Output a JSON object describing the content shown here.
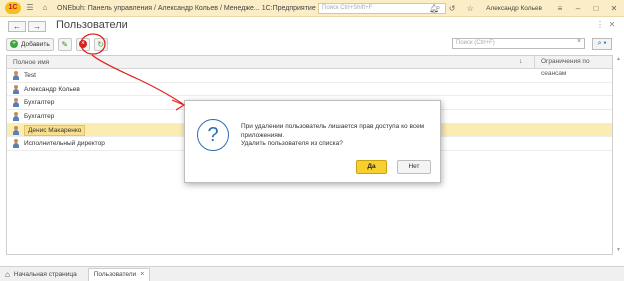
{
  "titlebar": {
    "logo": "1С",
    "title": "ONEbuh: Панель управления / Александр Кольев / Менедже... 1С:Предприятие",
    "search_placeholder": "Поиск Ctrl+Shift+F",
    "user": "Александр Кольев"
  },
  "page": {
    "title": "Пользователи"
  },
  "toolbar": {
    "add_label": "Добавить"
  },
  "search": {
    "placeholder": "Поиск (Ctrl+F)"
  },
  "table": {
    "columns": [
      "Полное имя",
      "Ограничения по сеансам"
    ],
    "rows": [
      {
        "name": "Test"
      },
      {
        "name": "Александр Кольев"
      },
      {
        "name": "Бухгалтер"
      },
      {
        "name": "Бухгалтер"
      },
      {
        "name": "Денис Макаренко",
        "selected": true
      },
      {
        "name": "Исполнительный директор"
      }
    ]
  },
  "dialog": {
    "message_line1": "При удалении пользователь лишается прав доступа ко всем",
    "message_line2": "приложениям.",
    "message_line3": "Удалить пользователя из списка?",
    "yes_label": "Да",
    "no_label": "Нет"
  },
  "tabs": [
    {
      "label": "Начальная страница"
    },
    {
      "label": "Пользователи",
      "active": true
    }
  ],
  "colors": {
    "accent_yellow": "#f7cf2f",
    "titlebar_bg": "#fbeec6",
    "annotation_red": "#e0211d",
    "selection": "#fbecb2"
  }
}
